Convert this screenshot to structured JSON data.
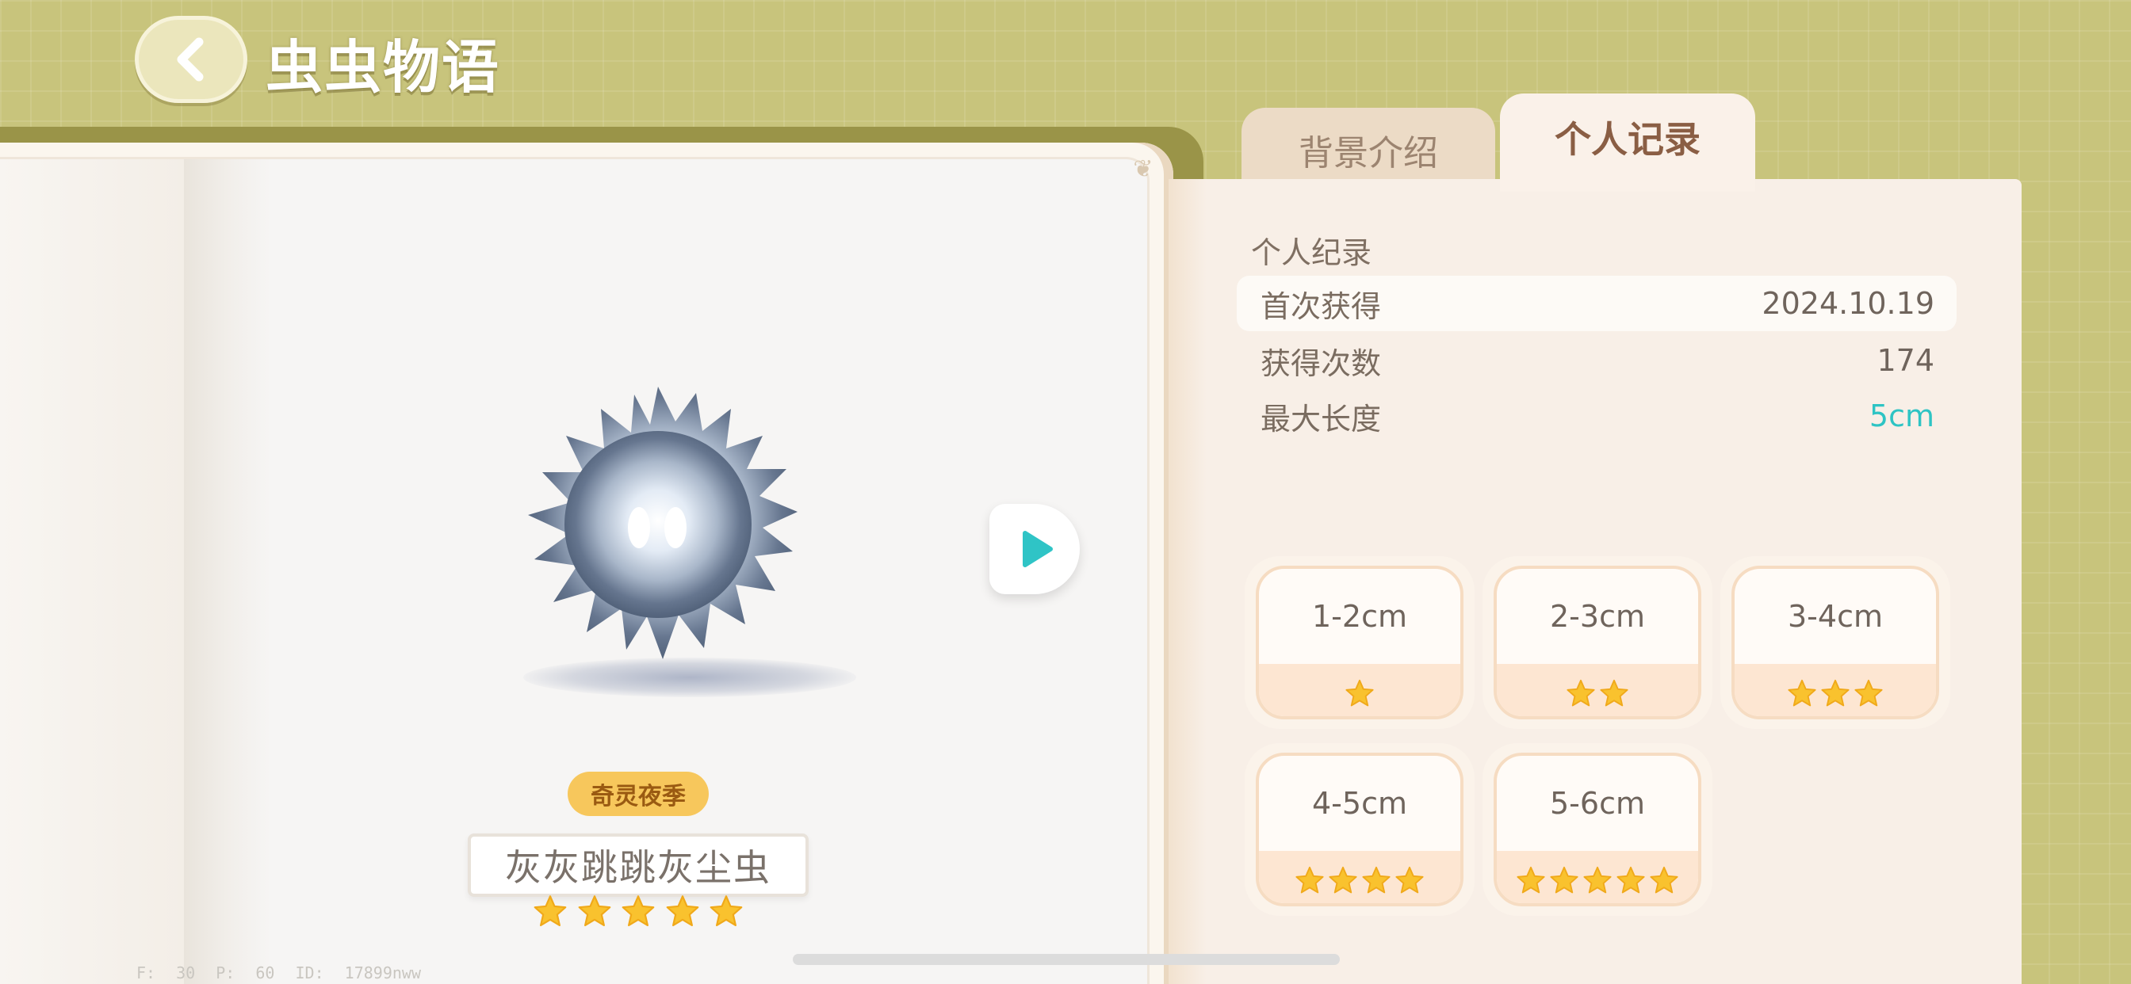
{
  "header": {
    "title": "虫虫物语"
  },
  "book": {
    "season_badge": "奇灵夜季",
    "creature_name": "灰灰跳跳灰尘虫",
    "creature_stars": 5,
    "debug": "F: 30   P: 60   ID: 17899nww"
  },
  "tabs": [
    {
      "label": "背景介绍",
      "active": false
    },
    {
      "label": "个人记录",
      "active": true
    }
  ],
  "record": {
    "heading": "个人纪录",
    "rows": [
      {
        "label": "首次获得",
        "value": "2024.10.19"
      },
      {
        "label": "获得次数",
        "value": "174"
      },
      {
        "label": "最大长度",
        "value": "5cm"
      }
    ]
  },
  "size_tiers": [
    {
      "label": "1-2cm",
      "stars": 1
    },
    {
      "label": "2-3cm",
      "stars": 2
    },
    {
      "label": "3-4cm",
      "stars": 3
    },
    {
      "label": "4-5cm",
      "stars": 4
    },
    {
      "label": "5-6cm",
      "stars": 5
    }
  ],
  "colors": {
    "background": "#c8c47c",
    "accent_value": "#2ec4c4",
    "star": "#f9c22e",
    "badge": "#f7c75c",
    "play_icon": "#2fc4c6"
  },
  "icons": {
    "back": "chevron-left-icon",
    "play": "play-icon",
    "star": "star-icon"
  }
}
